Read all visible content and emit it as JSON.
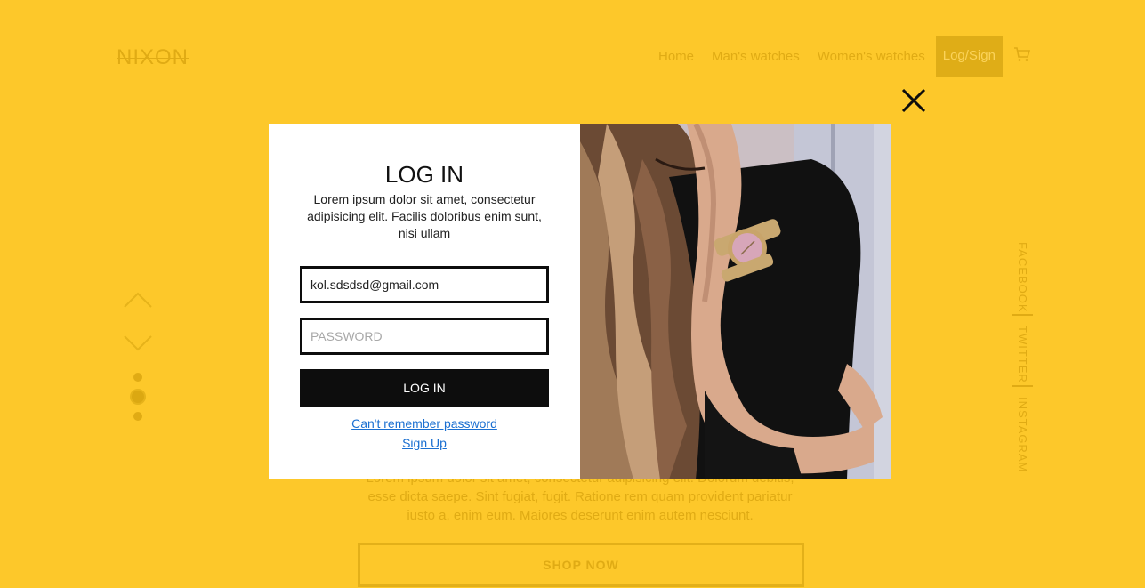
{
  "brand": {
    "logo_text": "NIXON"
  },
  "nav": {
    "items": [
      {
        "label": "Home"
      },
      {
        "label": "Man's watches"
      },
      {
        "label": "Women's watches"
      }
    ],
    "login_label": "Log/Sign",
    "cart_icon": "cart-icon"
  },
  "slider": {
    "up_icon": "chevron-up-icon",
    "down_icon": "chevron-down-icon",
    "dots_total": 3,
    "active_dot": 2
  },
  "social": {
    "items": [
      {
        "label": "FACEBOOK"
      },
      {
        "label": "TWITTER"
      },
      {
        "label": "INSTAGRAM"
      }
    ]
  },
  "hero": {
    "text": "Lorem ipsum dolor sit amet, consectetur adipisicing elit. Dolorum debitis, esse dicta saepe. Sint fugiat, fugit. Ratione rem quam provident pariatur iusto a, enim eum. Maiores deserunt enim autem nesciunt.",
    "cta_label": "SHOP NOW"
  },
  "modal": {
    "close_icon": "close-icon",
    "title": "LOG IN",
    "description": "Lorem ipsum dolor sit amet, consectetur adipisicing elit. Facilis doloribus enim sunt, nisi ullam",
    "email_value": "kol.sdsdsd@gmail.com",
    "password_placeholder": "PASSWORD",
    "submit_label": "LOG IN",
    "forgot_label": "Can't remember password",
    "signup_label": "Sign Up",
    "photo": "woman-wearing-watch-photo"
  },
  "colors": {
    "background": "#fdc82a",
    "accent_dark": "#0d0d0d",
    "link": "#1a6fd1"
  }
}
